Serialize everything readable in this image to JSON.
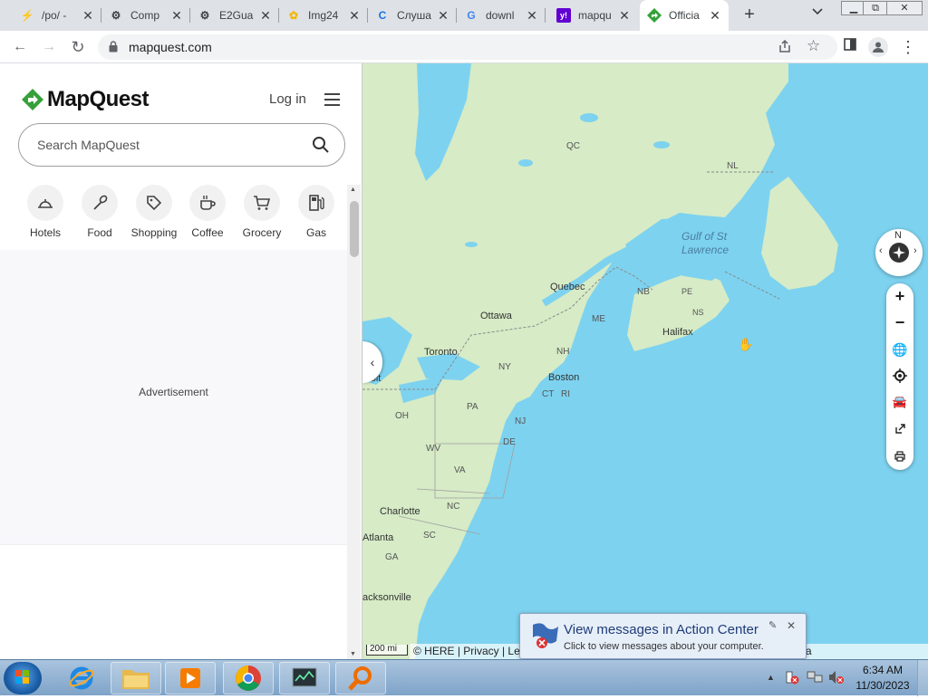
{
  "browser": {
    "tabs": [
      {
        "title": "/po/ -",
        "icon": "lightning-icon",
        "color": "#e8710a",
        "glyph": "⚡"
      },
      {
        "title": "Comp",
        "icon": "robot-icon",
        "color": "#3c4043",
        "glyph": "🤖"
      },
      {
        "title": "E2Gua",
        "icon": "robot-icon",
        "color": "#3c4043",
        "glyph": "🤖"
      },
      {
        "title": "Img24",
        "icon": "flower-icon",
        "color": "#f2b705",
        "glyph": "✿"
      },
      {
        "title": "Слуша",
        "icon": "refresh-c-icon",
        "color": "#1a73e8",
        "glyph": "C"
      },
      {
        "title": "downl",
        "icon": "google-icon",
        "color": "#4285f4",
        "glyph": "G"
      },
      {
        "title": "mapqu",
        "icon": "yahoo-icon",
        "color": "#6001d2",
        "glyph": "y!"
      },
      {
        "title": "Officia",
        "icon": "mapquest-icon",
        "color": "#36a03a",
        "glyph": "◆"
      }
    ],
    "new_tab": "+",
    "tab_search": "⌄",
    "win_min": "▭",
    "win_max": "⧉",
    "win_close": "✕",
    "url": "mapquest.com",
    "back": "←",
    "forward": "→",
    "reload": "↻",
    "share": "⇪",
    "star": "☆",
    "sidepanel": "▮",
    "more": "⋮"
  },
  "panel": {
    "logo": "MapQuest",
    "login": "Log in",
    "search_placeholder": "Search MapQuest",
    "categories": [
      {
        "label": "Hotels",
        "icon": "hotel-bell-icon"
      },
      {
        "label": "Food",
        "icon": "utensils-icon"
      },
      {
        "label": "Shopping",
        "icon": "tag-icon"
      },
      {
        "label": "Coffee",
        "icon": "coffee-cup-icon"
      },
      {
        "label": "Grocery",
        "icon": "cart-icon"
      },
      {
        "label": "Gas",
        "icon": "gas-pump-icon"
      }
    ],
    "advertisement": "Advertisement",
    "colors": {
      "brand": "#36a03a"
    }
  },
  "map": {
    "labels": {
      "qc": "QC",
      "nl": "NL",
      "gulf1": "Gulf of St",
      "gulf2": "Lawrence",
      "quebec": "Quebec",
      "nb": "NB",
      "pe": "PE",
      "ns": "NS",
      "ottawa": "Ottawa",
      "me": "ME",
      "halifax": "Halifax",
      "toronto": "Toronto",
      "nh": "NH",
      "ny": "NY",
      "troit": "troit",
      "boston": "Boston",
      "ct": "CT",
      "ri": "RI",
      "oh": "OH",
      "pa": "PA",
      "nj": "NJ",
      "de": "DE",
      "wv": "WV",
      "va": "VA",
      "charlotte": "Charlotte",
      "nc": "NC",
      "atlanta": "Atlanta",
      "sc": "SC",
      "ga": "GA",
      "jacksonville": "acksonville"
    },
    "compass_n": "N",
    "zoom_in": "+",
    "zoom_out": "−",
    "scale": "200 mi",
    "attribution": "© HERE | Privacy | Legal | About Our Ads | Do Not Sell or Share my Personal Data",
    "collapse": "‹",
    "colors": {
      "water": "#7dd2ef",
      "land": "#d6ebc6"
    }
  },
  "notification": {
    "title": "View messages in Action Center",
    "subtitle": "Click to view messages about your computer."
  },
  "taskbar": {
    "time": "6:34 AM",
    "date": "11/30/2023",
    "apps": [
      "internet-explorer-icon",
      "folder-icon",
      "media-player-icon",
      "chrome-icon",
      "task-manager-icon",
      "search-magnifier-icon"
    ]
  }
}
